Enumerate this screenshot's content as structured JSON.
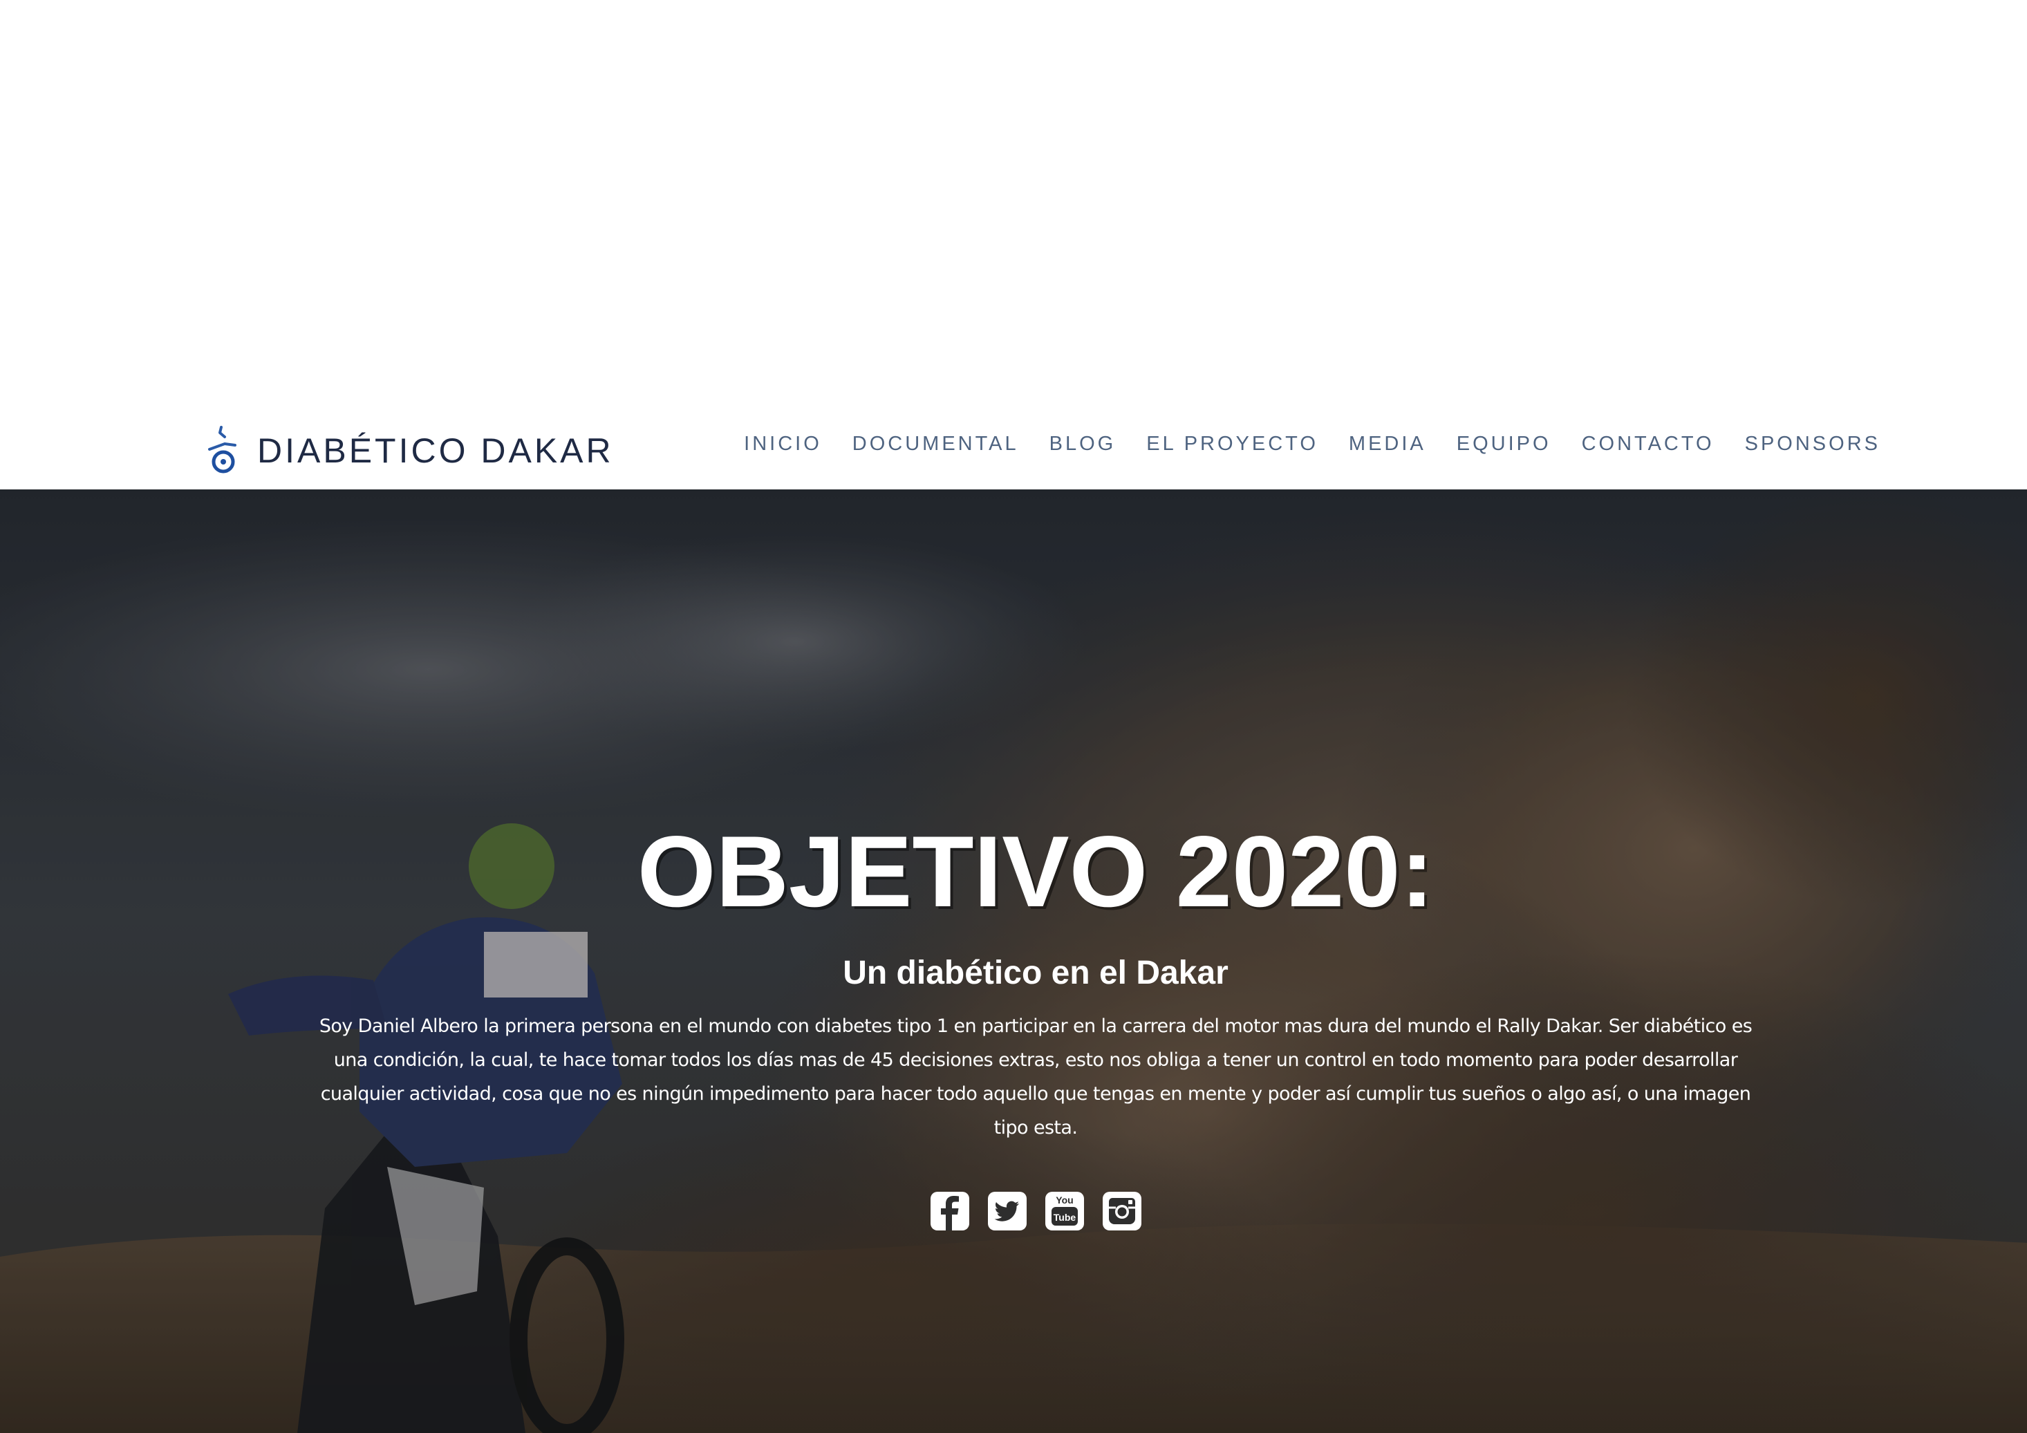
{
  "header": {
    "brand": "DIABÉTICO DAKAR",
    "logo_icon": "diabetic-dakar-logo-icon"
  },
  "nav": {
    "items": [
      {
        "label": "INICIO"
      },
      {
        "label": "DOCUMENTAL"
      },
      {
        "label": "BLOG"
      },
      {
        "label": "EL PROYECTO"
      },
      {
        "label": "MEDIA"
      },
      {
        "label": "EQUIPO"
      },
      {
        "label": "CONTACTO"
      },
      {
        "label": "SPONSORS"
      }
    ]
  },
  "hero": {
    "title": "OBJETIVO 2020:",
    "subtitle": "Un diabético en el Dakar",
    "text": "Soy Daniel Albero la primera persona en el mundo con diabetes tipo 1 en participar en la carrera del motor mas dura del mundo el Rally Dakar. Ser diabético es una condición, la cual, te hace tomar todos los días mas de 45 decisiones extras, esto nos obliga a tener un control en todo momento para poder desarrollar cualquier actividad, cosa que no es ningún impedimento para hacer todo aquello que tengas en mente y poder así cumplir tus sueños o algo así, o una imagen tipo esta."
  },
  "social": {
    "icons": [
      "facebook-icon",
      "twitter-icon",
      "youtube-icon",
      "instagram-icon"
    ],
    "youtube_label_top": "You",
    "youtube_label_bottom": "Tube"
  },
  "colors": {
    "brand_text": "#1f2a44",
    "nav_text": "#4e6380",
    "hero_text": "#ffffff"
  }
}
